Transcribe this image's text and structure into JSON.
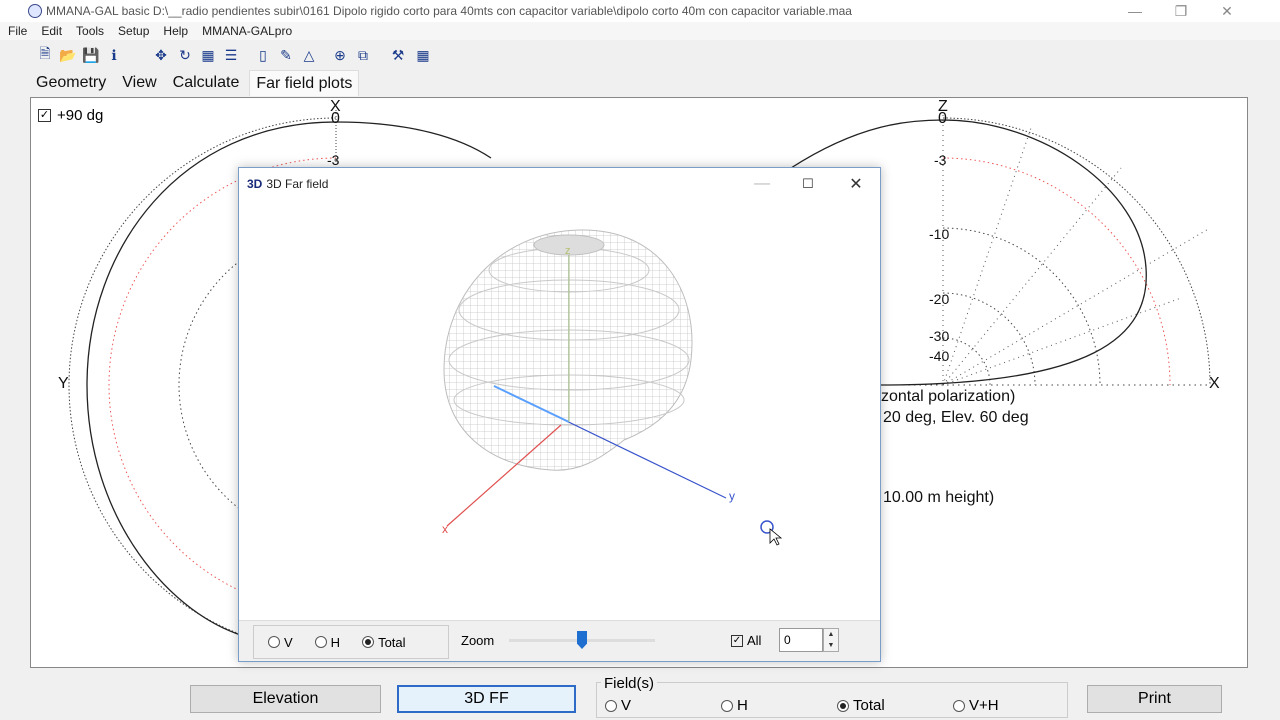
{
  "window": {
    "title": "MMANA-GAL basic D:\\__radio pendientes subir\\0161 Dipolo rigido corto para 40mts con capacitor variable\\dipolo corto 40m con capacitor variable.maa"
  },
  "menu": [
    "File",
    "Edit",
    "Tools",
    "Setup",
    "Help",
    "MMANA-GALpro"
  ],
  "tabs": [
    "Geometry",
    "View",
    "Calculate",
    "Far field plots"
  ],
  "plot": {
    "checkbox_label": "+90 dg",
    "left_axis": {
      "top": "X",
      "left": "Y",
      "zero": "0",
      "minus3": "-3"
    },
    "right_axis": {
      "top": "Z",
      "right": "X",
      "zero": "0",
      "ticks": [
        "-3",
        "-10",
        "-20",
        "-30",
        "-40"
      ]
    },
    "info_line1": "zontal polarization)",
    "info_line2": "20 deg,  Elev. 60 deg",
    "info_line3": "10.00 m height)"
  },
  "dialog": {
    "badge": "3D",
    "title": "3D Far field",
    "axis_x": "x",
    "axis_y": "y",
    "axis_z": "z",
    "radios": [
      {
        "label": "V",
        "checked": false
      },
      {
        "label": "H",
        "checked": false
      },
      {
        "label": "Total",
        "checked": true
      }
    ],
    "zoom_label": "Zoom",
    "all_label": "All",
    "all_checked": true,
    "spin_value": "0"
  },
  "bottom": {
    "elevation": "Elevation",
    "ff3d": "3D FF",
    "fields_legend": "Field(s)",
    "field_options": [
      {
        "label": "V",
        "checked": false
      },
      {
        "label": "H",
        "checked": false
      },
      {
        "label": "Total",
        "checked": true
      },
      {
        "label": "V+H",
        "checked": false
      }
    ],
    "print": "Print"
  }
}
